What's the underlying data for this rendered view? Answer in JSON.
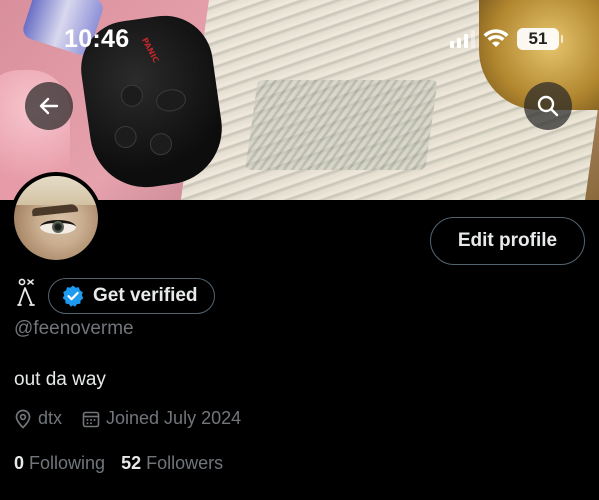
{
  "status_bar": {
    "time": "10:46",
    "battery": "51"
  },
  "banner": {
    "fob_text": "PANIC"
  },
  "profile": {
    "edit_label": "Edit profile",
    "verify_label": "Get verified",
    "handle": "@feenoverme",
    "bio": "out da way",
    "location": "dtx",
    "joined": "Joined July 2024",
    "following_count": "0",
    "following_label": "Following",
    "followers_count": "52",
    "followers_label": "Followers"
  },
  "colors": {
    "background": "#000000",
    "verified_badge": "#1d9bf0",
    "muted_text": "#71767b",
    "border": "#536471"
  },
  "icons": [
    "back-arrow-icon",
    "search-icon",
    "verified-badge-icon",
    "location-pin-icon",
    "calendar-icon",
    "wifi-icon",
    "signal-icon",
    "battery-icon",
    "name-glyph-icon"
  ]
}
